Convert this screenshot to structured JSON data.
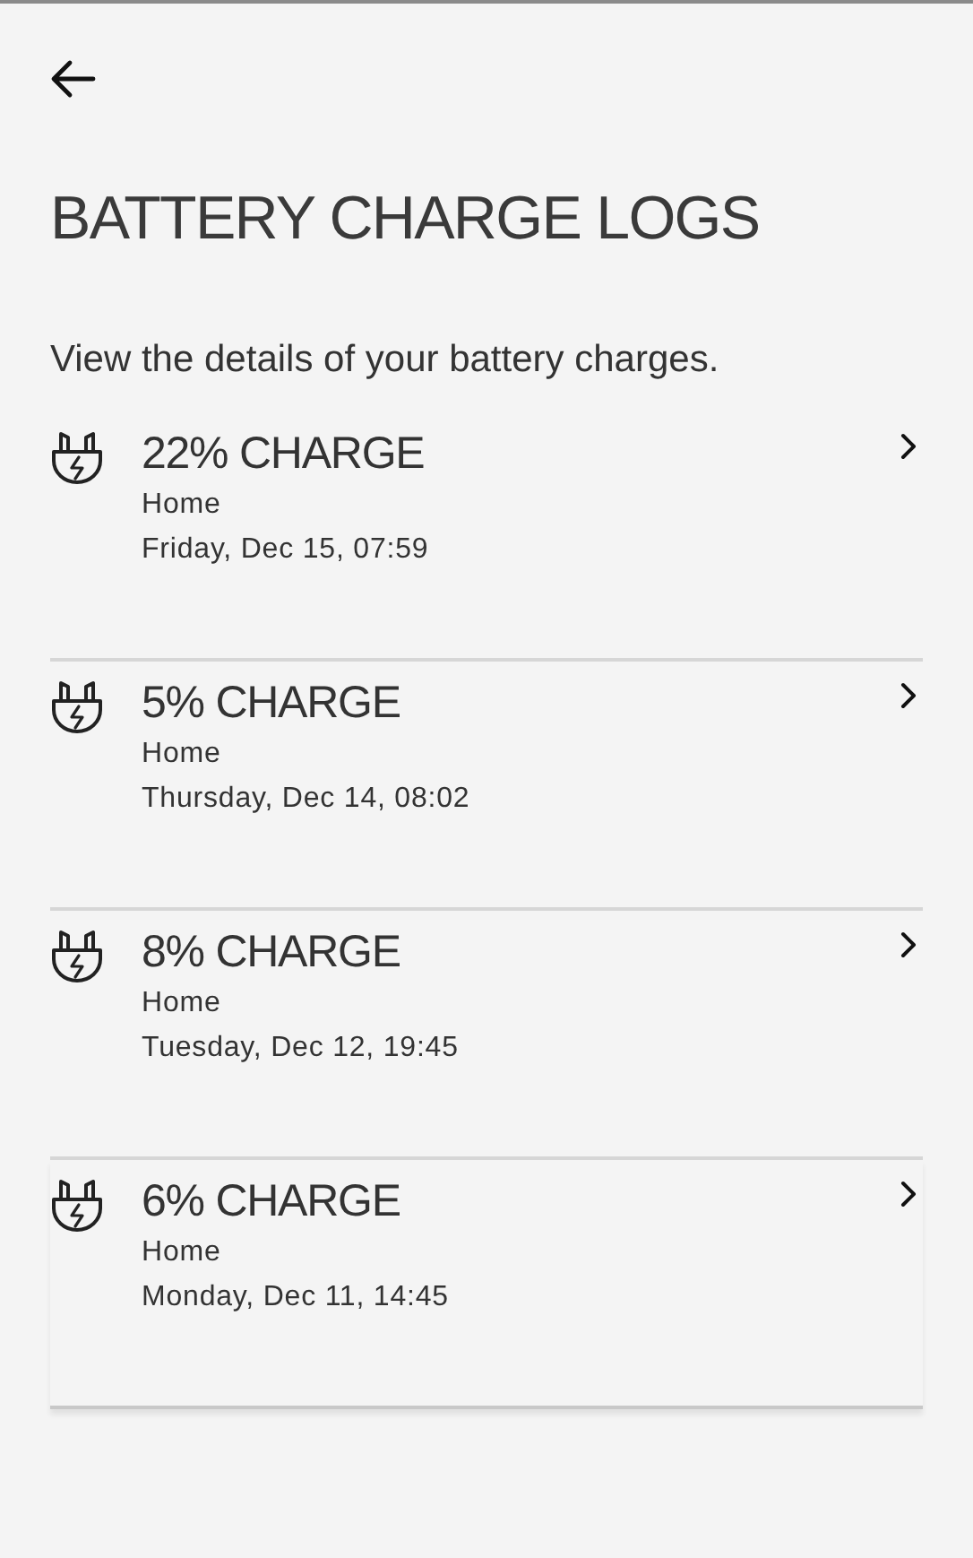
{
  "header": {
    "title": "BATTERY CHARGE LOGS",
    "subtitle": "View the details of your battery charges."
  },
  "logs": [
    {
      "charge": "22% CHARGE",
      "location": "Home",
      "date": "Friday, Dec 15, 07:59"
    },
    {
      "charge": "5% CHARGE",
      "location": "Home",
      "date": "Thursday, Dec 14, 08:02"
    },
    {
      "charge": "8% CHARGE",
      "location": "Home",
      "date": "Tuesday, Dec 12, 19:45"
    },
    {
      "charge": "6% CHARGE",
      "location": "Home",
      "date": "Monday, Dec 11, 14:45"
    }
  ]
}
